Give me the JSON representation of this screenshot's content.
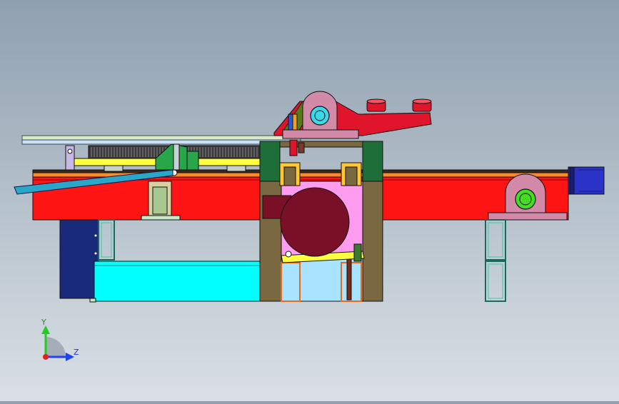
{
  "triad": {
    "y_label": "Y",
    "z_label": "Z",
    "y_color": "#22cc22",
    "z_color": "#2244ee",
    "origin_color": "#dd2222"
  },
  "colors": {
    "frame_red": "#ff1414",
    "frame_top": "#3a2a1e",
    "frame_orange": "#ff8a2a",
    "column_brown": "#7a6840",
    "column_green": "#1e6e3a",
    "tank_cyan": "#00ffff",
    "tank_lightblue": "#a8e4ff",
    "motor_navy": "#1a2a7a",
    "drive_motor_blue": "#2a32c8",
    "drum_maroon": "#7a1028",
    "inner_pink": "#ff9cf0",
    "belt_yellow": "#ffff40",
    "plate_grey": "#c8d0c8",
    "chute_teal": "#2aa6c8",
    "bracket_green": "#2aa64a",
    "bearing_mauve": "#d28aa8",
    "bearing_bore_cyan": "#3ad8e8",
    "bearing_bore_green": "#44dd22",
    "hopper_red": "#e0142a"
  }
}
